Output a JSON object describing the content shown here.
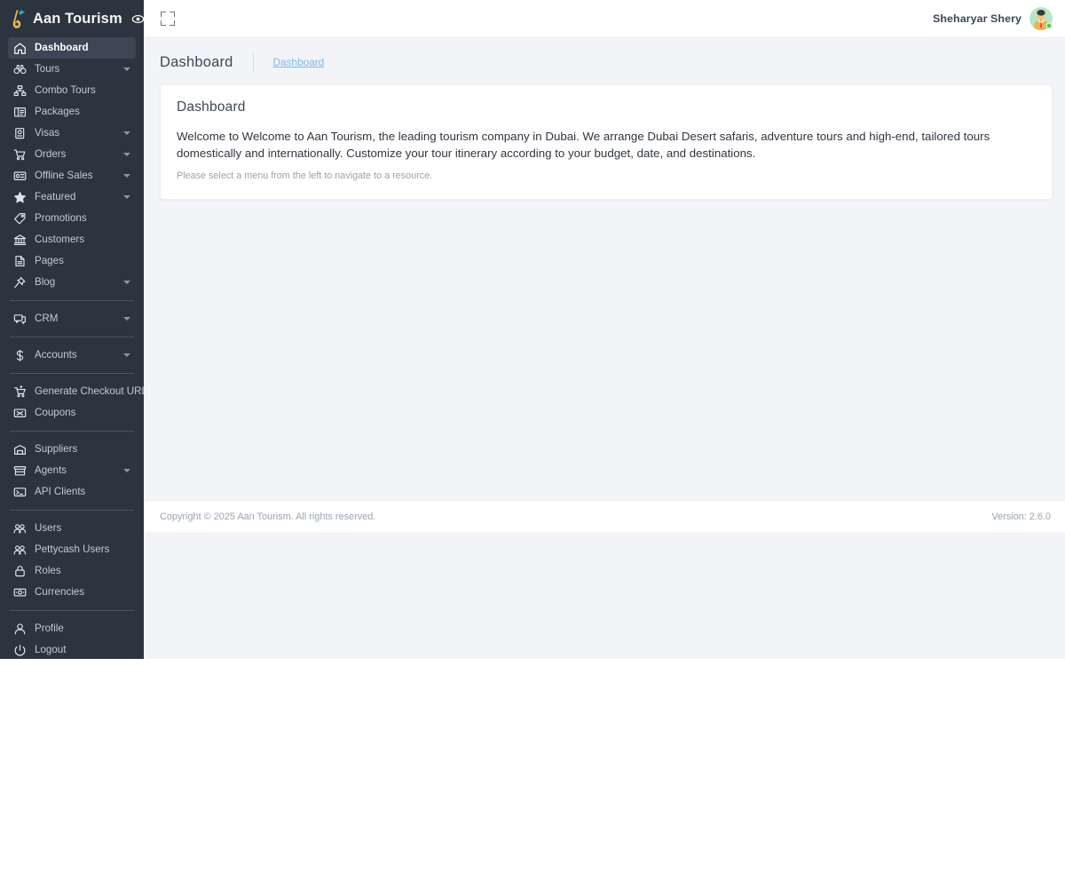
{
  "brand": {
    "title": "Aan Tourism",
    "logo_icon": "tourism-logo-icon",
    "eye_icon": "eye-icon"
  },
  "topbar": {
    "fullscreen_icon": "fullscreen-expand-icon",
    "user_name": "Sheharyar Shery",
    "avatar_icon": "user-avatar",
    "status": "online"
  },
  "page": {
    "title": "Dashboard",
    "breadcrumb": "Dashboard"
  },
  "card": {
    "title": "Dashboard",
    "body": "Welcome to Welcome to Aan Tourism, the leading tourism company in Dubai. We arrange Dubai Desert safaris, adventure tours and high-end, tailored tours domestically and internationally. Customize your tour itinerary according to your budget, date, and destinations.",
    "note": "Please select a menu from the left to navigate to a resource."
  },
  "footer": {
    "copyright": "Copyright © 2025 Aan Tourism. All rights reserved.",
    "version": "Version: 2.6.0"
  },
  "colors": {
    "sidebar_bg": "#2b343f",
    "sidebar_active_bg": "#3c4654",
    "content_bg": "#f2f4f7",
    "breadcrumb_link": "#7ab6e8",
    "accent_green": "#3ecf6a"
  },
  "sidebar": {
    "items": [
      {
        "label": "Dashboard",
        "icon": "home-icon",
        "active": true,
        "caret": false,
        "sep_after": false
      },
      {
        "label": "Tours",
        "icon": "binoculars-icon",
        "active": false,
        "caret": true,
        "sep_after": false
      },
      {
        "label": "Combo Tours",
        "icon": "sitemap-icon",
        "active": false,
        "caret": false,
        "sep_after": false
      },
      {
        "label": "Packages",
        "icon": "package-icon",
        "active": false,
        "caret": false,
        "sep_after": false
      },
      {
        "label": "Visas",
        "icon": "passport-icon",
        "active": false,
        "caret": true,
        "sep_after": false
      },
      {
        "label": "Orders",
        "icon": "cart-icon",
        "active": false,
        "caret": true,
        "sep_after": false
      },
      {
        "label": "Offline Sales",
        "icon": "card-sale-icon",
        "active": false,
        "caret": true,
        "sep_after": false
      },
      {
        "label": "Featured",
        "icon": "star-icon",
        "active": false,
        "caret": true,
        "sep_after": false
      },
      {
        "label": "Promotions",
        "icon": "tag-icon",
        "active": false,
        "caret": false,
        "sep_after": false
      },
      {
        "label": "Customers",
        "icon": "bank-icon",
        "active": false,
        "caret": false,
        "sep_after": false
      },
      {
        "label": "Pages",
        "icon": "file-icon",
        "active": false,
        "caret": false,
        "sep_after": false
      },
      {
        "label": "Blog",
        "icon": "pin-icon",
        "active": false,
        "caret": true,
        "sep_after": true
      },
      {
        "label": "CRM",
        "icon": "chat-icon",
        "active": false,
        "caret": true,
        "sep_after": true
      },
      {
        "label": "Accounts",
        "icon": "dollar-icon",
        "active": false,
        "caret": true,
        "sep_after": true
      },
      {
        "label": "Generate Checkout URL",
        "icon": "checkout-cart-icon",
        "active": false,
        "caret": false,
        "sep_after": false
      },
      {
        "label": "Coupons",
        "icon": "coupon-icon",
        "active": false,
        "caret": false,
        "sep_after": true
      },
      {
        "label": "Suppliers",
        "icon": "warehouse-icon",
        "active": false,
        "caret": false,
        "sep_after": false
      },
      {
        "label": "Agents",
        "icon": "store-icon",
        "active": false,
        "caret": true,
        "sep_after": false
      },
      {
        "label": "API Clients",
        "icon": "terminal-icon",
        "active": false,
        "caret": false,
        "sep_after": true
      },
      {
        "label": "Users",
        "icon": "users-icon",
        "active": false,
        "caret": false,
        "sep_after": false
      },
      {
        "label": "Pettycash Users",
        "icon": "users-icon",
        "active": false,
        "caret": false,
        "sep_after": false
      },
      {
        "label": "Roles",
        "icon": "lock-icon",
        "active": false,
        "caret": false,
        "sep_after": false
      },
      {
        "label": "Currencies",
        "icon": "money-icon",
        "active": false,
        "caret": false,
        "sep_after": true
      },
      {
        "label": "Profile",
        "icon": "person-icon",
        "active": false,
        "caret": false,
        "sep_after": false
      },
      {
        "label": "Logout",
        "icon": "power-icon",
        "active": false,
        "caret": false,
        "sep_after": false
      }
    ]
  }
}
